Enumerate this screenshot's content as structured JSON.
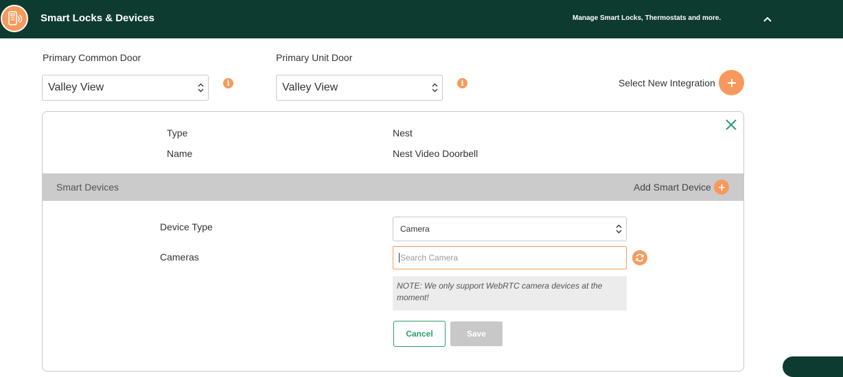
{
  "header": {
    "title": "Smart Locks & Devices",
    "subtitle": "Manage Smart Locks, Thermostats and more."
  },
  "doors": {
    "common": {
      "label": "Primary Common Door",
      "value": "Valley View"
    },
    "unit": {
      "label": "Primary Unit Door",
      "value": "Valley View"
    },
    "info_glyph": "i"
  },
  "integration": {
    "label": "Select New Integration"
  },
  "panel": {
    "type_label": "Type",
    "type_value": "Nest",
    "name_label": "Name",
    "name_value": "Nest Video Doorbell",
    "smart_devices_title": "Smart Devices",
    "add_smart_device_label": "Add Smart Device",
    "device_type_label": "Device Type",
    "device_type_value": "Camera",
    "cameras_label": "Cameras",
    "camera_search_placeholder": "Search Camera",
    "note": "NOTE: We only support WebRTC camera devices at the moment!",
    "cancel_label": "Cancel",
    "save_label": "Save"
  },
  "colors": {
    "header_bg": "#0d3b30",
    "accent_orange": "#f7995d",
    "accent_green": "#2a9d6a",
    "band_gray": "#cbcbcb"
  },
  "icons": {
    "logo": "smart-lock-icon",
    "collapse": "chevron-up-icon",
    "info": "info-icon",
    "add": "plus-icon",
    "close": "close-icon",
    "refresh": "refresh-icon",
    "select": "select-arrows-icon"
  }
}
